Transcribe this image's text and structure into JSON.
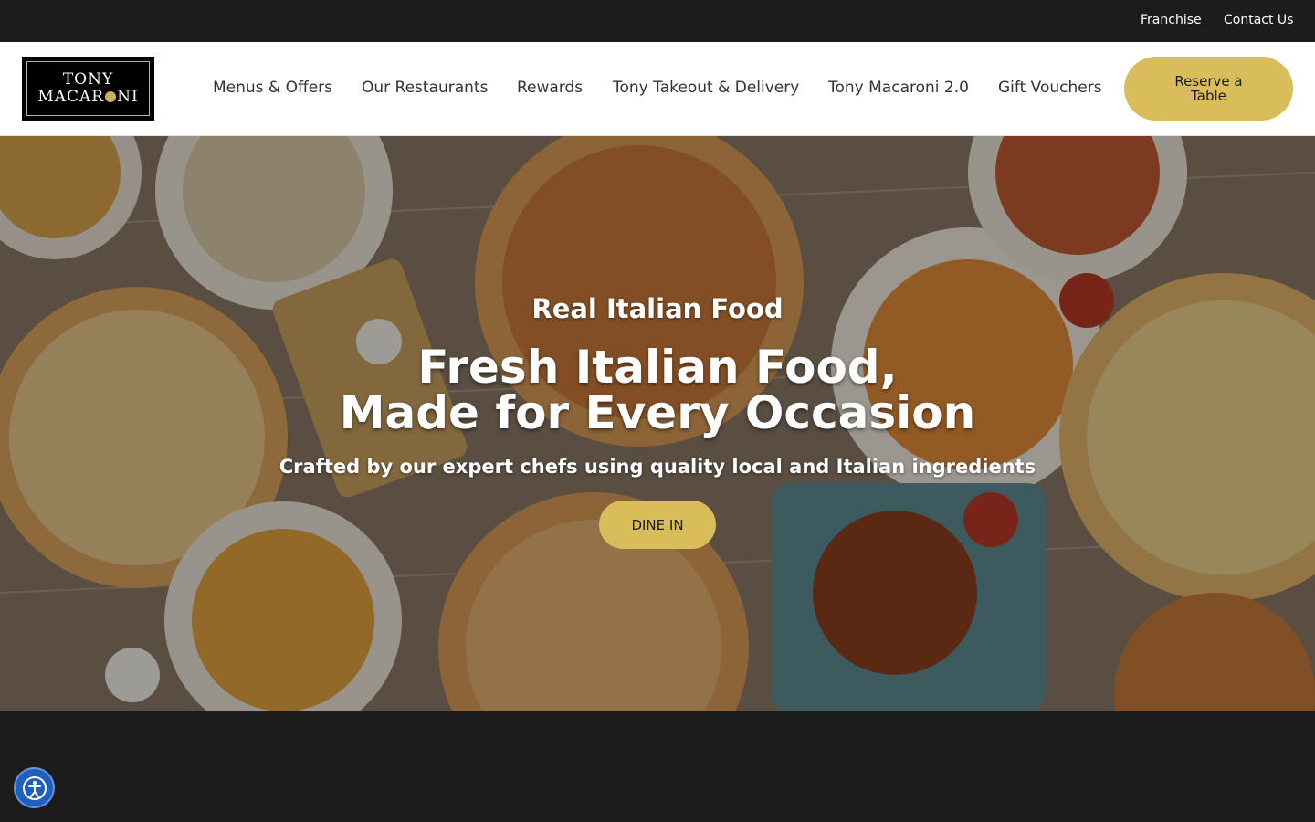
{
  "topbar": {
    "franchise": "Franchise",
    "contact": "Contact Us"
  },
  "logo": {
    "line1": "TONY",
    "line2_left": "MACAR",
    "line2_right": "NI"
  },
  "nav": {
    "items": [
      {
        "label": "Menus & Offers"
      },
      {
        "label": "Our Restaurants"
      },
      {
        "label": "Rewards"
      },
      {
        "label": "Tony Takeout & Delivery"
      },
      {
        "label": "Tony Macaroni 2.0"
      },
      {
        "label": "Gift Vouchers"
      }
    ],
    "reserve_label": "Reserve a Table"
  },
  "hero": {
    "eyebrow": "Real Italian Food",
    "title_line1": "Fresh Italian Food,",
    "title_line2": "Made for Every Occasion",
    "subtitle": "Crafted by our expert chefs using quality local and Italian ingredients",
    "cta_label": "DINE IN"
  },
  "colors": {
    "accent": "#d8bd5a",
    "dark": "#1c1c1c",
    "a11y_blue": "#1f5fbf"
  },
  "icons": {
    "accessibility": "accessibility-icon"
  }
}
